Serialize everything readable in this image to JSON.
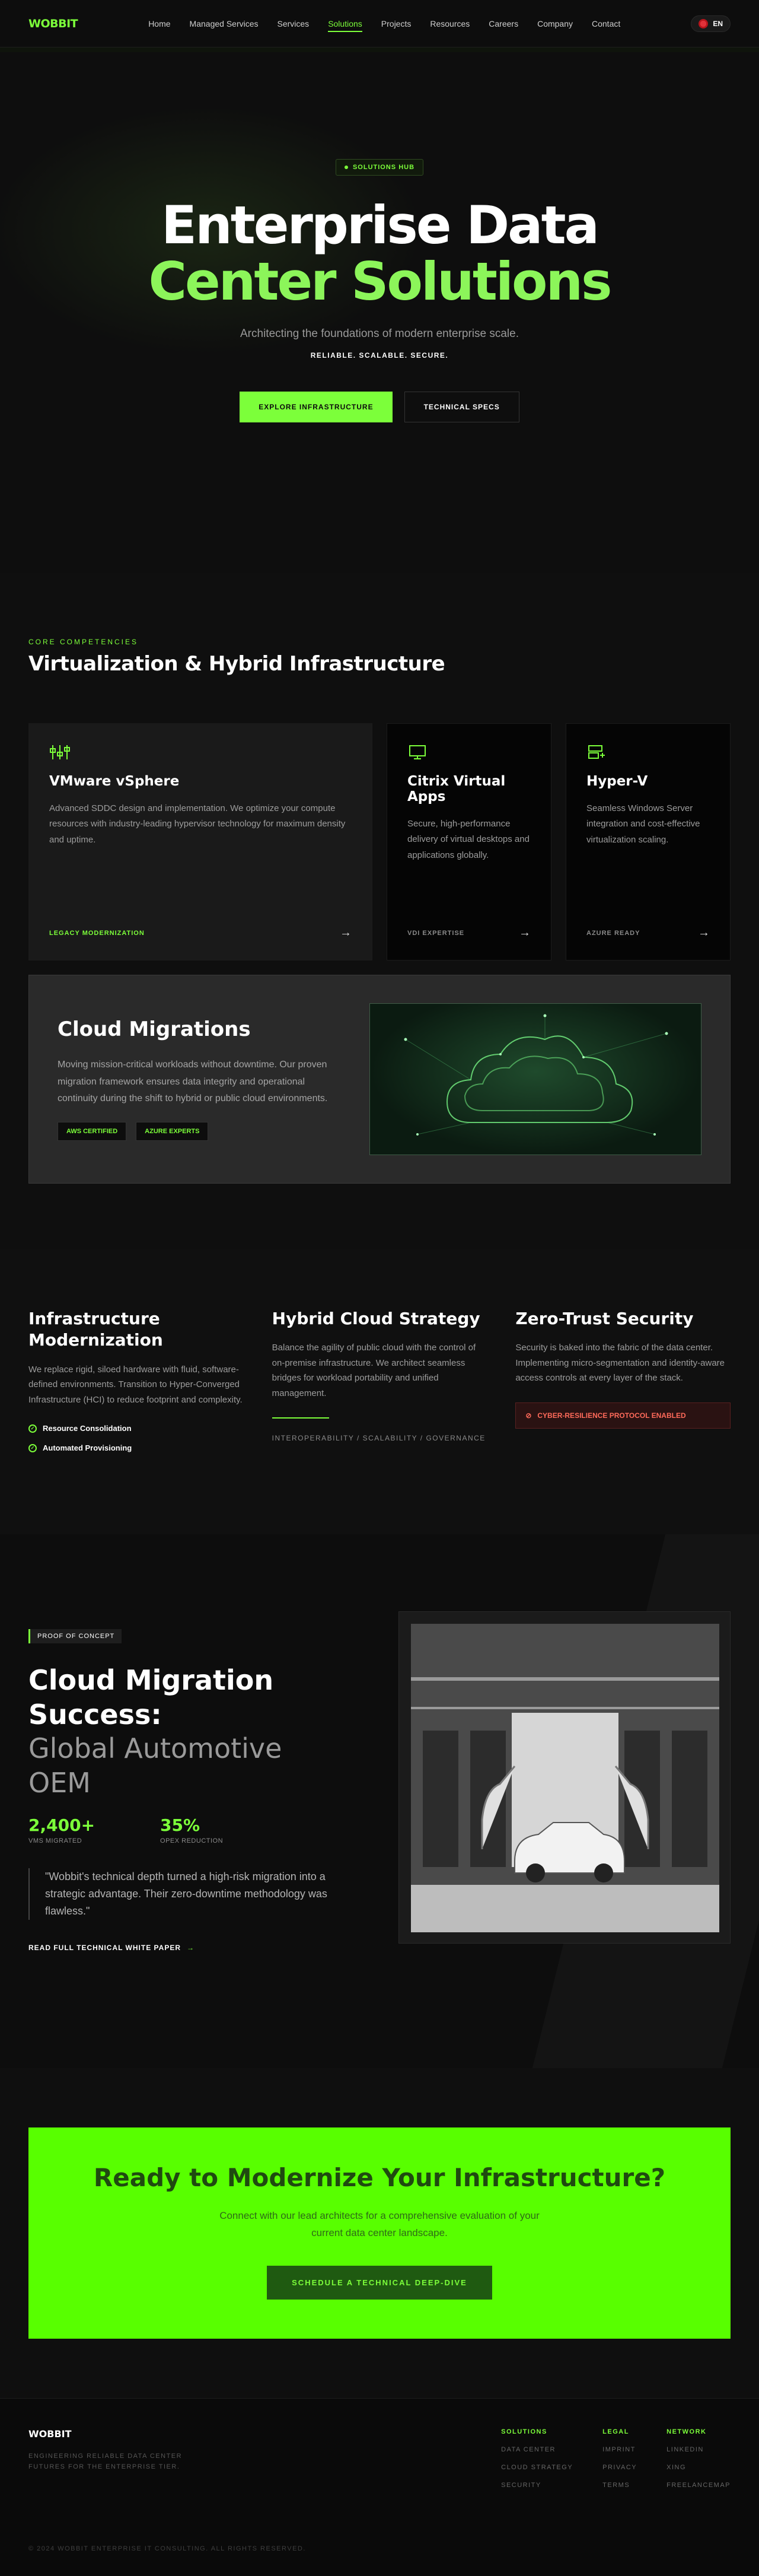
{
  "nav": {
    "logo": "WOBBIT",
    "links": [
      "Home",
      "Managed Services",
      "Services",
      "Solutions",
      "Projects",
      "Resources",
      "Careers",
      "Company",
      "Contact"
    ],
    "language": "EN"
  },
  "hero": {
    "badge": "SOLUTIONS HUB",
    "title_line1": "Enterprise Data",
    "title_line2": "Center Solutions",
    "subtitle": "Architecting the foundations of modern enterprise scale.",
    "tagline": "RELIABLE. SCALABLE. SECURE.",
    "primary_cta": "EXPLORE INFRASTRUCTURE",
    "secondary_cta": "TECHNICAL SPECS"
  },
  "competencies": {
    "eyebrow": "CORE COMPETENCIES",
    "title": "Virtualization & Hybrid Infrastructure",
    "cards": [
      {
        "title": "VMware vSphere",
        "body": "Advanced SDDC design and implementation. We optimize your compute resources with industry-leading hypervisor technology for maximum density and uptime.",
        "label": "LEGACY MODERNIZATION",
        "icon": "sliders-icon"
      },
      {
        "title": "Citrix Virtual Apps",
        "body": "Secure, high-performance delivery of virtual desktops and applications globally.",
        "label": "VDI EXPERTISE",
        "icon": "monitor-icon"
      },
      {
        "title": "Hyper-V",
        "body": "Seamless Windows Server integration and cost-effective virtualization scaling.",
        "label": "AZURE READY",
        "icon": "server-icon"
      }
    ],
    "migrations": {
      "title": "Cloud Migrations",
      "body": "Moving mission-critical workloads without downtime. Our proven migration framework ensures data integrity and operational continuity during the shift to hybrid or public cloud environments.",
      "tags": [
        "AWS CERTIFIED",
        "AZURE EXPERTS"
      ]
    }
  },
  "pillars": {
    "modernization": {
      "title": "Infrastructure Modernization",
      "body": "We replace rigid, siloed hardware with fluid, software-defined environments. Transition to Hyper-Converged Infrastructure (HCI) to reduce footprint and complexity.",
      "checks": [
        "Resource Consolidation",
        "Automated Provisioning"
      ]
    },
    "hybrid": {
      "title": "Hybrid Cloud Strategy",
      "body": "Balance the agility of public cloud with the control of on-premise infrastructure. We architect seamless bridges for workload portability and unified management.",
      "meta": "INTEROPERABILITY / SCALABILITY / GOVERNANCE"
    },
    "zerotrust": {
      "title": "Zero-Trust Security",
      "body": "Security is baked into the fabric of the data center. Implementing micro-segmentation and identity-aware access controls at every layer of the stack.",
      "alert": "CYBER-RESILIENCE PROTOCOL ENABLED"
    }
  },
  "case_study": {
    "badge": "PROOF OF CONCEPT",
    "title_line1": "Cloud Migration",
    "title_line2": "Success:",
    "title_line3": "Global Automotive OEM",
    "stats": [
      {
        "value": "2,400+",
        "label": "VMS MIGRATED"
      },
      {
        "value": "35%",
        "label": "OPEX REDUCTION"
      }
    ],
    "quote": "\"Wobbit's technical depth turned a high-risk migration into a strategic advantage. Their zero-downtime methodology was flawless.\"",
    "link": "READ FULL TECHNICAL WHITE PAPER"
  },
  "cta": {
    "title": "Ready to Modernize Your Infrastructure?",
    "body": "Connect with our lead architects for a comprehensive evaluation of your current data center landscape.",
    "button": "SCHEDULE A TECHNICAL DEEP-DIVE"
  },
  "footer": {
    "brand": "WOBBIT",
    "description": "ENGINEERING RELIABLE DATA CENTER FUTURES FOR THE ENTERPRISE TIER.",
    "columns": [
      {
        "heading": "SOLUTIONS",
        "links": [
          "DATA CENTER",
          "CLOUD STRATEGY",
          "SECURITY"
        ]
      },
      {
        "heading": "LEGAL",
        "links": [
          "IMPRINT",
          "PRIVACY",
          "TERMS"
        ]
      },
      {
        "heading": "NETWORK",
        "links": [
          "LINKEDIN",
          "XING",
          "FREELANCEMAP"
        ]
      }
    ],
    "copyright": "© 2024 WOBBIT ENTERPRISE IT CONSULTING. ALL RIGHTS RESERVED."
  },
  "colors": {
    "accent": "#7CFF3A",
    "cta_bg": "#58FF00",
    "alert": "#FF6A5A"
  }
}
